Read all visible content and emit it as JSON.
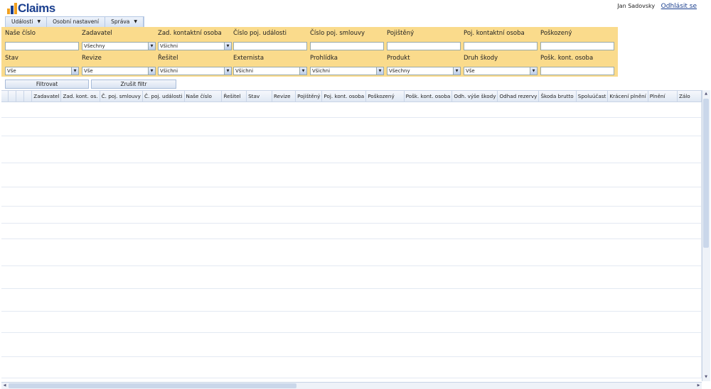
{
  "app": {
    "logo_text": "Claims"
  },
  "user": {
    "name": "Jan Sadovsky",
    "logout": "Odhlásit se"
  },
  "menu": [
    {
      "label": "Události",
      "caret": true
    },
    {
      "label": "Osobní nastavení",
      "caret": false
    },
    {
      "label": "Správa",
      "caret": true
    }
  ],
  "filters": {
    "nase_cislo": {
      "label": "Naše číslo",
      "value": ""
    },
    "zadavatel": {
      "label": "Zadavatel",
      "value": "Všechny"
    },
    "zad_kontaktni_osoba": {
      "label": "Zad. kontaktní osoba",
      "value": "Všichni"
    },
    "cislo_poj_udalosti": {
      "label": "Číslo poj. události",
      "value": ""
    },
    "cislo_poj_smlouvy": {
      "label": "Číslo poj. smlouvy",
      "value": ""
    },
    "pojisteny": {
      "label": "Pojištěný",
      "value": ""
    },
    "poj_kontaktni_osoba": {
      "label": "Poj. kontaktní osoba",
      "value": ""
    },
    "poskozeny": {
      "label": "Poškozený",
      "value": ""
    },
    "stav": {
      "label": "Stav",
      "value": "Vše"
    },
    "revize": {
      "label": "Revize",
      "value": "Vše"
    },
    "resitel": {
      "label": "Řešitel",
      "value": "Všichni"
    },
    "externista": {
      "label": "Externista",
      "value": "Všichni"
    },
    "prohlidka": {
      "label": "Prohlídka",
      "value": "Všichni"
    },
    "produkt": {
      "label": "Produkt",
      "value": "Všechny"
    },
    "druh_skody": {
      "label": "Druh škody",
      "value": "Vše"
    },
    "posk_kont_osoba": {
      "label": "Pošk. kont. osoba",
      "value": ""
    }
  },
  "buttons": {
    "filter": "Filtrovat",
    "clear": "Zrušit filtr"
  },
  "grid": {
    "columns": [
      "Zadavatel",
      "Zad. kont. os.",
      "Č. poj. smlouvy",
      "Č. poj. události",
      "Naše číslo",
      "Řešitel",
      "Stav",
      "Revize",
      "Pojištěný",
      "Poj. kont. osoba",
      "Poškozený",
      "Pošk. kont. osoba",
      "Odh. výše škody",
      "Odhad rezervy",
      "Škoda brutto",
      "Spoluúčast",
      "Krácení plnění",
      "Plnění",
      "Zálo"
    ]
  },
  "icons": {
    "dropdown": "chevron-down-icon",
    "scroll_up": "arrow-up-icon",
    "scroll_down": "arrow-down-icon",
    "scroll_left": "arrow-left-icon",
    "scroll_right": "arrow-right-icon"
  },
  "colors": {
    "filter_bg": "#fadb8c",
    "brand": "#1a3f8f",
    "accent": "#f0a020"
  }
}
